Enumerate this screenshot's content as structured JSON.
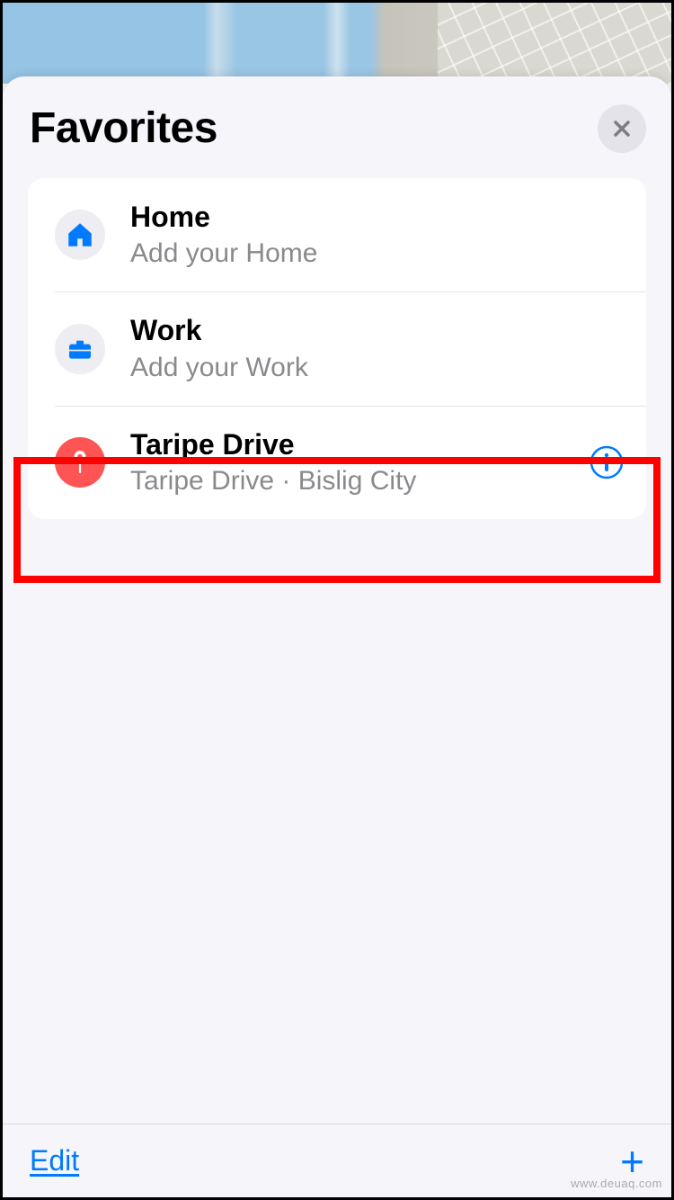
{
  "header": {
    "title": "Favorites"
  },
  "favorites": [
    {
      "title": "Home",
      "subtitle": "Add your Home"
    },
    {
      "title": "Work",
      "subtitle": "Add your Work"
    },
    {
      "title": "Taripe Drive",
      "subtitle": "Taripe Drive · Bislig City"
    }
  ],
  "footer": {
    "edit": "Edit",
    "add": "+"
  },
  "watermark": "www.deuaq.com",
  "colors": {
    "accent": "#007aff",
    "pin": "#ff5454",
    "highlight": "#ff0000"
  }
}
